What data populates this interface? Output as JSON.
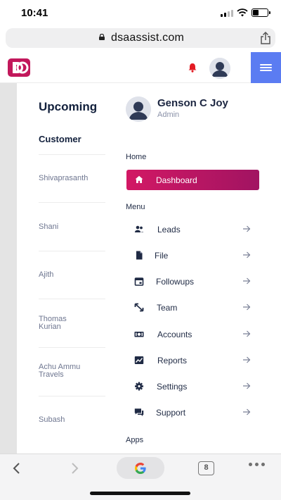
{
  "status_bar": {
    "time": "10:41"
  },
  "browser": {
    "domain": "dsaassist.com",
    "tab_count": "8"
  },
  "header": {
    "logo": "app-logo",
    "notification_icon": "bell-icon",
    "menu_icon": "hamburger-icon"
  },
  "background_page": {
    "heading": "Upcoming",
    "column_header": "Customer",
    "rows": [
      [
        "Shivaprasanth"
      ],
      [
        "Shani"
      ],
      [
        "Ajith"
      ],
      [
        "Thomas",
        "Kurian"
      ],
      [
        "Achu Ammu",
        "Travels"
      ],
      [
        "Subash"
      ]
    ]
  },
  "drawer": {
    "user_name": "Genson C Joy",
    "user_role": "Admin",
    "sections": {
      "home": "Home",
      "menu": "Menu",
      "apps": "Apps"
    },
    "active_item": {
      "label": "Dashboard",
      "icon": "home-icon"
    },
    "items": [
      {
        "label": "Leads",
        "icon": "people-icon"
      },
      {
        "label": "File",
        "icon": "file-icon"
      },
      {
        "label": "Followups",
        "icon": "calendar-icon"
      },
      {
        "label": "Team",
        "icon": "arrows-diagonal-icon"
      },
      {
        "label": "Accounts",
        "icon": "money-icon"
      },
      {
        "label": "Reports",
        "icon": "chart-icon"
      },
      {
        "label": "Settings",
        "icon": "gear-icon"
      },
      {
        "label": "Support",
        "icon": "chat-icon"
      }
    ]
  },
  "colors": {
    "accent_blue": "#5b7cf2",
    "active_gradient_start": "#d21864",
    "active_gradient_end": "#a11462",
    "bell_red": "#e31b23"
  }
}
